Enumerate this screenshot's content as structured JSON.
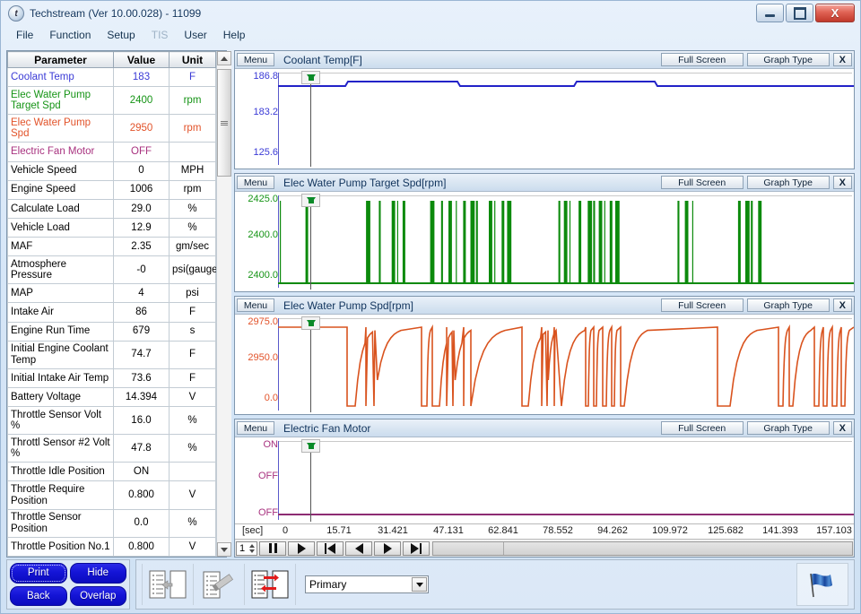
{
  "window": {
    "title": "Techstream (Ver 10.00.028) - 11099",
    "icon": "app-logo-icon",
    "minimize_label": "minimize",
    "maximize_label": "maximize",
    "close_label": "X"
  },
  "menubar": {
    "items": [
      {
        "label": "File",
        "disabled": false
      },
      {
        "label": "Function",
        "disabled": false
      },
      {
        "label": "Setup",
        "disabled": false
      },
      {
        "label": "TIS",
        "disabled": true
      },
      {
        "label": "User",
        "disabled": false
      },
      {
        "label": "Help",
        "disabled": false
      }
    ]
  },
  "parameter_table": {
    "headers": {
      "parameter": "Parameter",
      "value": "Value",
      "unit": "Unit"
    },
    "rows": [
      {
        "parameter": "Coolant Temp",
        "value": "183",
        "unit": "F",
        "color": "#3a3ad6"
      },
      {
        "parameter": "Elec Water Pump Target Spd",
        "value": "2400",
        "unit": "rpm",
        "color": "#169416"
      },
      {
        "parameter": "Elec Water Pump Spd",
        "value": "2950",
        "unit": "rpm",
        "color": "#e2532a"
      },
      {
        "parameter": "Electric Fan Motor",
        "value": "OFF",
        "unit": "",
        "color": "#a8327f"
      },
      {
        "parameter": "Vehicle Speed",
        "value": "0",
        "unit": "MPH",
        "color": "#000000"
      },
      {
        "parameter": "Engine Speed",
        "value": "1006",
        "unit": "rpm",
        "color": "#000000"
      },
      {
        "parameter": "Calculate Load",
        "value": "29.0",
        "unit": "%",
        "color": "#000000"
      },
      {
        "parameter": "Vehicle Load",
        "value": "12.9",
        "unit": "%",
        "color": "#000000"
      },
      {
        "parameter": "MAF",
        "value": "2.35",
        "unit": "gm/sec",
        "color": "#000000"
      },
      {
        "parameter": "Atmosphere Pressure",
        "value": "-0",
        "unit": "psi(gauge)",
        "color": "#000000"
      },
      {
        "parameter": "MAP",
        "value": "4",
        "unit": "psi",
        "color": "#000000"
      },
      {
        "parameter": "Intake Air",
        "value": "86",
        "unit": "F",
        "color": "#000000"
      },
      {
        "parameter": "Engine Run Time",
        "value": "679",
        "unit": "s",
        "color": "#000000"
      },
      {
        "parameter": "Initial Engine Coolant Temp",
        "value": "74.7",
        "unit": "F",
        "color": "#000000"
      },
      {
        "parameter": "Initial Intake Air Temp",
        "value": "73.6",
        "unit": "F",
        "color": "#000000"
      },
      {
        "parameter": "Battery Voltage",
        "value": "14.394",
        "unit": "V",
        "color": "#000000"
      },
      {
        "parameter": "Throttle Sensor Volt %",
        "value": "16.0",
        "unit": "%",
        "color": "#000000"
      },
      {
        "parameter": "Throttl Sensor #2 Volt %",
        "value": "47.8",
        "unit": "%",
        "color": "#000000"
      },
      {
        "parameter": "Throttle Idle Position",
        "value": "ON",
        "unit": "",
        "color": "#000000"
      },
      {
        "parameter": "Throttle Require Position",
        "value": "0.800",
        "unit": "V",
        "color": "#000000"
      },
      {
        "parameter": "Throttle Sensor Position",
        "value": "0.0",
        "unit": "%",
        "color": "#000000"
      },
      {
        "parameter": "Throttle Position No.1",
        "value": "0.800",
        "unit": "V",
        "color": "#000000"
      }
    ]
  },
  "graph_panels": [
    {
      "menu_label": "Menu",
      "title": "Coolant Temp[F]",
      "fullscreen_label": "Full Screen",
      "graphtype_label": "Graph Type",
      "close_label": "X",
      "y_labels": [
        "186.8",
        "183.2",
        "125.6"
      ],
      "color": "#2222c8"
    },
    {
      "menu_label": "Menu",
      "title": "Elec Water Pump Target Spd[rpm]",
      "fullscreen_label": "Full Screen",
      "graphtype_label": "Graph Type",
      "close_label": "X",
      "y_labels": [
        "2425.0",
        "2400.0",
        "2400.0"
      ],
      "color": "#0c8a0c"
    },
    {
      "menu_label": "Menu",
      "title": "Elec Water Pump Spd[rpm]",
      "fullscreen_label": "Full Screen",
      "graphtype_label": "Graph Type",
      "close_label": "X",
      "y_labels": [
        "2975.0",
        "2950.0",
        "0.0"
      ],
      "color": "#d9531e"
    },
    {
      "menu_label": "Menu",
      "title": "Electric Fan Motor",
      "fullscreen_label": "Full Screen",
      "graphtype_label": "Graph Type",
      "close_label": "X",
      "y_labels": [
        "ON",
        "OFF",
        "OFF"
      ],
      "color": "#8d2c73"
    }
  ],
  "time_axis": {
    "unit_label": "[sec]",
    "ticks": [
      "0",
      "15.71",
      "31.421",
      "47.131",
      "62.841",
      "78.552",
      "94.262",
      "109.972",
      "125.682",
      "141.393",
      "157.103"
    ]
  },
  "playback": {
    "speed_value": "1",
    "buttons": [
      {
        "name": "pause-button",
        "glyph": "pause"
      },
      {
        "name": "play-button",
        "glyph": "play"
      },
      {
        "name": "skip-start-button",
        "glyph": "skip-back"
      },
      {
        "name": "step-back-button",
        "glyph": "step-back"
      },
      {
        "name": "step-forward-button",
        "glyph": "step-forward"
      },
      {
        "name": "skip-end-button",
        "glyph": "skip-forward"
      }
    ]
  },
  "bottom_toolbar": {
    "buttons": [
      {
        "label": "Print",
        "name": "print-button"
      },
      {
        "label": "Hide",
        "name": "hide-button"
      },
      {
        "label": "Back",
        "name": "back-button"
      },
      {
        "label": "Overlap",
        "name": "overlap-button"
      }
    ],
    "icons": [
      {
        "name": "copy-to-list-icon"
      },
      {
        "name": "edit-list-icon"
      },
      {
        "name": "compare-list-icon"
      }
    ],
    "dropdown": {
      "value": "Primary",
      "name": "data-source-select"
    },
    "flag_icon": "blue-flag-icon"
  },
  "chart_data": [
    {
      "type": "line",
      "title": "Coolant Temp[F]",
      "ylabel": "F",
      "xlabel": "[sec]",
      "ytick_labels": [
        "186.8",
        "183.2",
        "125.6"
      ],
      "ylim": [
        125.6,
        186.8
      ],
      "xlim": [
        0,
        157.103
      ],
      "series": [
        {
          "name": "Coolant Temp",
          "color": "#2222c8",
          "x": [
            0,
            18,
            19,
            60,
            61,
            100,
            101,
            157.103
          ],
          "values": [
            185.1,
            185.1,
            185.7,
            185.7,
            185.1,
            185.1,
            185.7,
            185.7
          ]
        }
      ],
      "cursor_time": 5.0,
      "grid": false,
      "legend": "none"
    },
    {
      "type": "line",
      "title": "Elec Water Pump Target Spd[rpm]",
      "ylabel": "rpm",
      "xlabel": "[sec]",
      "ytick_labels": [
        "2425.0",
        "2400.0",
        "2400.0"
      ],
      "ylim": [
        2400.0,
        2425.0
      ],
      "xlim": [
        0,
        157.103
      ],
      "series": [
        {
          "name": "Elec Water Pump Target Spd",
          "color": "#0c8a0c",
          "note": "Square-wave spikes between 2400 baseline and ~2422 peaks",
          "spike_times": [
            0.5,
            7.5,
            24.0,
            27.5,
            31.0,
            32.5,
            34.0,
            41.5,
            44.5,
            46.5,
            48.5,
            50.5,
            52.5,
            54.0,
            57.5,
            59.0,
            61.0,
            62.5,
            76.5,
            78.0,
            79.5,
            82.0,
            84.5,
            86.0,
            87.5,
            89.0,
            90.5,
            92.0,
            109.0,
            111.0,
            113.0,
            125.5,
            127.5,
            129.0,
            131.0
          ]
        }
      ],
      "cursor_time": 5.0,
      "grid": false,
      "legend": "none"
    },
    {
      "type": "line",
      "title": "Elec Water Pump Spd[rpm]",
      "ylabel": "rpm",
      "xlabel": "[sec]",
      "ytick_labels": [
        "2975.0",
        "2950.0",
        "0.0"
      ],
      "ylim": [
        0.0,
        2975.0
      ],
      "xlim": [
        0,
        157.103
      ],
      "series": [
        {
          "name": "Elec Water Pump Spd",
          "color": "#d9531e",
          "note": "Holds near 2970 with repeated drops to near 0 and exponential recoveries",
          "baseline": 2970,
          "drop_value": 120
        }
      ],
      "cursor_time": 5.0,
      "grid": false,
      "legend": "none"
    },
    {
      "type": "line",
      "title": "Electric Fan Motor",
      "ylabel": "",
      "xlabel": "[sec]",
      "ytick_labels": [
        "ON",
        "OFF",
        "OFF"
      ],
      "ylim": [
        0,
        2
      ],
      "xlim": [
        0,
        157.103
      ],
      "series": [
        {
          "name": "Electric Fan Motor",
          "color": "#8d2c73",
          "x": [
            0,
            157.103
          ],
          "values": [
            "OFF",
            "OFF"
          ]
        }
      ],
      "cursor_time": 5.0,
      "grid": false,
      "legend": "none"
    }
  ]
}
